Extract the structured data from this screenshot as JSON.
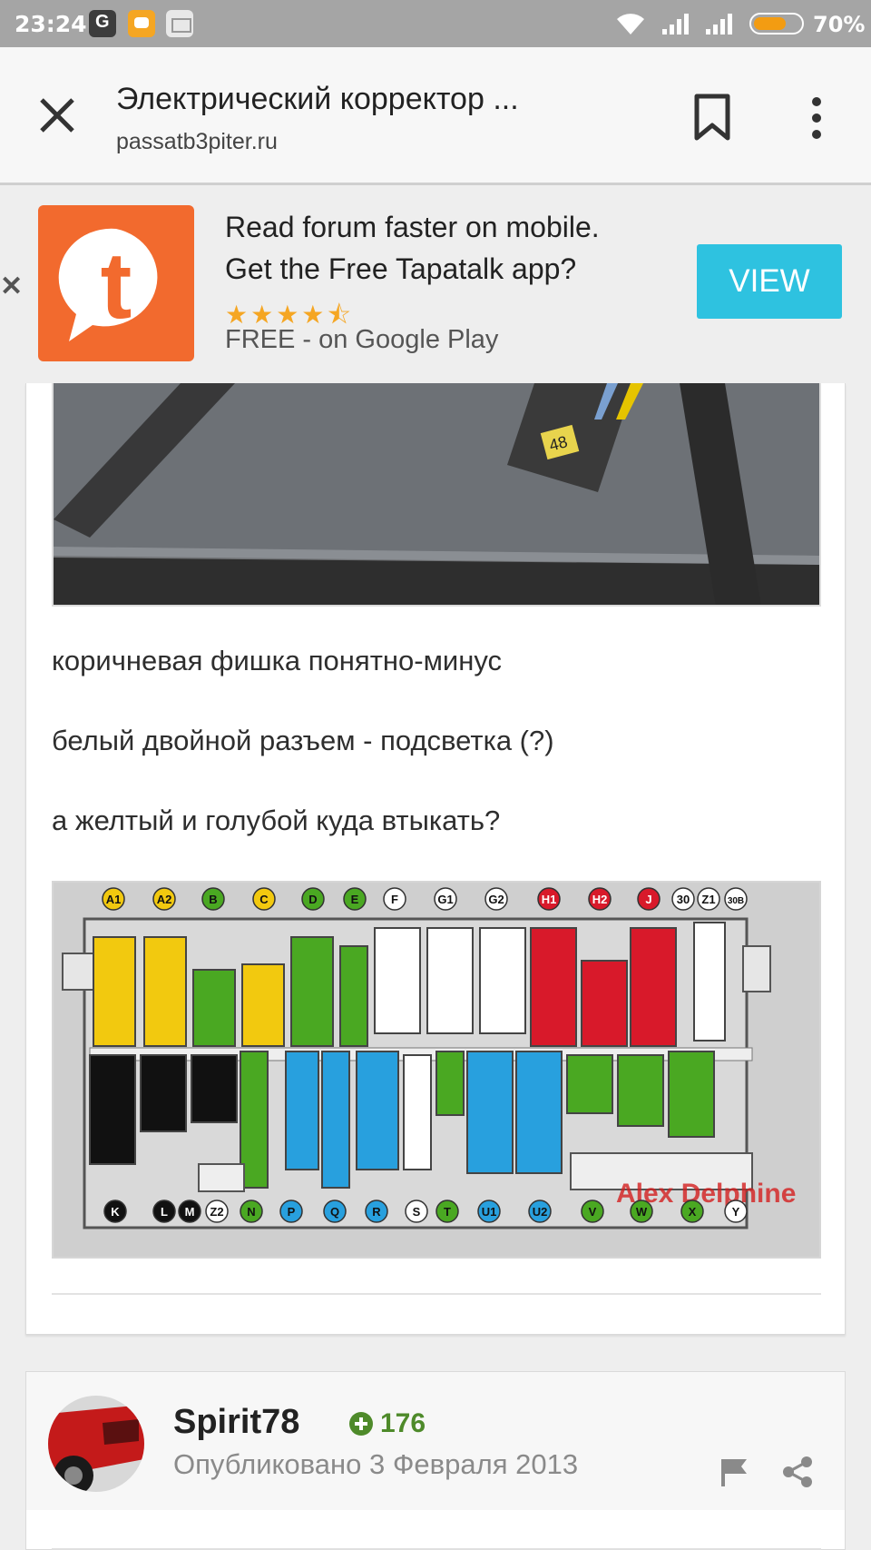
{
  "status_bar": {
    "time": "23:24",
    "battery_percent": "70%",
    "battery_level": 0.7
  },
  "toolbar": {
    "title": "Электрический корректор ...",
    "domain": "passatb3piter.ru"
  },
  "banner": {
    "line1": "Read forum faster on mobile.",
    "line2": "Get the Free Tapatalk app?",
    "rating": 4.5,
    "stars": "★★★★⯪",
    "line3": "FREE - on Google Play",
    "view_label": "VIEW",
    "logo_letter": "t",
    "accent": "#f26a2e",
    "button_color": "#2ec2e0"
  },
  "post": {
    "lines": [
      "коричневая фишка понятно-минус",
      "белый двойной разъем - подсветка (?)",
      "а желтый и голубой куда втыкать?"
    ],
    "photo_label": "48",
    "diagram": {
      "top_labels": [
        "A1",
        "A2",
        "B",
        "C",
        "D",
        "E",
        "F",
        "G1",
        "G2",
        "H1",
        "H2",
        "J",
        "30",
        "Z1",
        "30B"
      ],
      "bottom_labels": [
        "K",
        "L",
        "M",
        "Z2",
        "N",
        "P",
        "Q",
        "R",
        "S",
        "T",
        "U1",
        "U2",
        "V",
        "W",
        "X",
        "Y"
      ],
      "watermark": "Alex Delphine"
    }
  },
  "author": {
    "name": "Spirit78",
    "reputation": "176",
    "published": "Опубликовано 3 Февраля 2013"
  }
}
